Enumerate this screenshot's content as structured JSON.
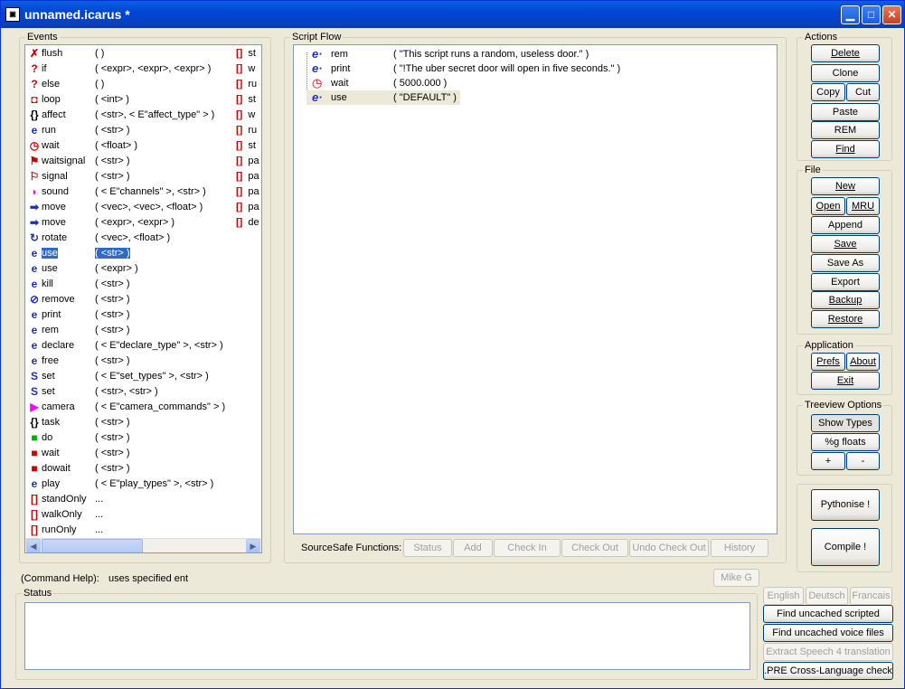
{
  "window": {
    "title": "unnamed.icarus *"
  },
  "events": {
    "legend": "Events",
    "items": [
      {
        "name": "flush",
        "args": "(  )",
        "icon": "flush-icon",
        "glyph": "✗",
        "color": "#d00000"
      },
      {
        "name": "if",
        "args": "( <expr>, <expr>, <expr> )",
        "icon": "if-icon",
        "glyph": "?",
        "color": "#d00000"
      },
      {
        "name": "else",
        "args": "(  )",
        "icon": "else-icon",
        "glyph": "?",
        "color": "#d00000"
      },
      {
        "name": "loop",
        "args": "( <int> )",
        "icon": "loop-icon",
        "glyph": "◘",
        "color": "#d00000"
      },
      {
        "name": "affect",
        "args": "( <str>, < E\"affect_type\" > )",
        "icon": "affect-icon",
        "glyph": "{}",
        "color": "#000000"
      },
      {
        "name": "run",
        "args": "( <str> )",
        "icon": "run-icon",
        "glyph": "e",
        "color": "#1d32b3"
      },
      {
        "name": "wait",
        "args": "( <float> )",
        "icon": "clock-icon",
        "glyph": "◷",
        "color": "#d00000"
      },
      {
        "name": "waitsignal",
        "args": "( <str> )",
        "icon": "waitsignal-icon",
        "glyph": "⚑",
        "color": "#d00000"
      },
      {
        "name": "signal",
        "args": "( <str> )",
        "icon": "signal-icon",
        "glyph": "⚐",
        "color": "#d00000"
      },
      {
        "name": "sound",
        "args": "( < E\"channels\" >, <str> )",
        "icon": "sound-icon",
        "glyph": "◗",
        "color": "#ff00ff"
      },
      {
        "name": "move",
        "args": "( <vec>, <vec>, <float> )",
        "icon": "move-arrow-icon",
        "glyph": "➡",
        "color": "#1d32b3"
      },
      {
        "name": "move",
        "args": "( <expr>, <expr> )",
        "icon": "move-arrow-icon",
        "glyph": "➡",
        "color": "#1d32b3"
      },
      {
        "name": "rotate",
        "args": "( <vec>, <float> )",
        "icon": "rotate-icon",
        "glyph": "↻",
        "color": "#1d32b3"
      },
      {
        "name": "use",
        "args": "( <str> )",
        "icon": "e-icon",
        "glyph": "e",
        "color": "#1d32b3"
      },
      {
        "name": "use",
        "args": "( <expr> )",
        "icon": "e-icon",
        "glyph": "e",
        "color": "#1d32b3"
      },
      {
        "name": "kill",
        "args": "( <str> )",
        "icon": "e-icon",
        "glyph": "e",
        "color": "#1d32b3"
      },
      {
        "name": "remove",
        "args": "( <str> )",
        "icon": "remove-icon",
        "glyph": "⊘",
        "color": "#1d32b3"
      },
      {
        "name": "print",
        "args": "( <str> )",
        "icon": "e-icon",
        "glyph": "e",
        "color": "#1d32b3"
      },
      {
        "name": "rem",
        "args": "( <str> )",
        "icon": "e-icon",
        "glyph": "e",
        "color": "#1d32b3"
      },
      {
        "name": "declare",
        "args": "( < E\"declare_type\" >, <str> )",
        "icon": "e-icon",
        "glyph": "e",
        "color": "#1d32b3"
      },
      {
        "name": "free",
        "args": "( <str> )",
        "icon": "e-icon",
        "glyph": "e",
        "color": "#1d32b3"
      },
      {
        "name": "set",
        "args": "( < E\"set_types\" >, <str> )",
        "icon": "set-icon",
        "glyph": "S",
        "color": "#1d32b3"
      },
      {
        "name": "set",
        "args": "( <str>, <str> )",
        "icon": "set-icon",
        "glyph": "S",
        "color": "#1d32b3"
      },
      {
        "name": "camera",
        "args": "( < E\"camera_commands\" > )",
        "icon": "camera-icon",
        "glyph": "▶",
        "color": "#ff00ff"
      },
      {
        "name": "task",
        "args": "( <str> )",
        "icon": "task-icon",
        "glyph": "{}",
        "color": "#000000"
      },
      {
        "name": "do",
        "args": "( <str> )",
        "icon": "do-icon",
        "glyph": "■",
        "color": "#00b000"
      },
      {
        "name": "wait",
        "args": "( <str> )",
        "icon": "wait-red-icon",
        "glyph": "■",
        "color": "#d00000"
      },
      {
        "name": "dowait",
        "args": "( <str> )",
        "icon": "dowait-icon",
        "glyph": "■",
        "color": "#d00000"
      },
      {
        "name": "play",
        "args": "( < E\"play_types\" >, <str> )",
        "icon": "e-icon",
        "glyph": "e",
        "color": "#1d32b3"
      },
      {
        "name": "standOnly",
        "args": "...",
        "icon": "bracket-icon",
        "glyph": "[]",
        "color": "#d00000"
      },
      {
        "name": "walkOnly",
        "args": "...",
        "icon": "bracket-icon",
        "glyph": "[]",
        "color": "#d00000"
      },
      {
        "name": "runOnly",
        "args": "...",
        "icon": "bracket-icon",
        "glyph": "[]",
        "color": "#d00000"
      }
    ],
    "second_column": [
      "st",
      "w",
      "ru",
      "st",
      "w",
      "ru",
      "st",
      "pa",
      "pa",
      "pa",
      "pa",
      "de"
    ]
  },
  "script_flow": {
    "legend": "Script Flow",
    "rows": [
      {
        "name": "rem",
        "args": "( \"This script runs a random, useless door.\" )",
        "icon": "e-icon"
      },
      {
        "name": "print",
        "args": "( \"!The uber secret door will open in five seconds.\" )",
        "icon": "e-icon"
      },
      {
        "name": "wait",
        "args": "( 5000.000 )",
        "icon": "clock-icon"
      },
      {
        "name": "use",
        "args": "( \"DEFAULT\" )",
        "icon": "e-icon"
      }
    ]
  },
  "sourcesafe": {
    "label": "SourceSafe Functions:",
    "buttons": [
      "Status",
      "Add",
      "Check In",
      "Check Out",
      "Undo Check Out",
      "History"
    ]
  },
  "actions": {
    "legend": "Actions",
    "delete": "Delete",
    "clone": "Clone",
    "copy": "Copy",
    "cut": "Cut",
    "paste": "Paste",
    "rem": "REM",
    "find": "Find"
  },
  "file": {
    "legend": "File",
    "new": "New",
    "open": "Open",
    "mru": "MRU",
    "append": "Append",
    "save": "Save",
    "save_as": "Save As",
    "export": "Export",
    "backup": "Backup",
    "restore": "Restore"
  },
  "application": {
    "legend": "Application",
    "prefs": "Prefs",
    "about": "About",
    "exit": "Exit"
  },
  "treeview": {
    "legend": "Treeview Options",
    "show_types": "Show Types",
    "g_floats": "%g floats",
    "plus": "+",
    "minus": "-"
  },
  "build": {
    "pythonise": "Pythonise !",
    "compile": "Compile !"
  },
  "command_help": {
    "label": "(Command Help):",
    "text": "uses specified ent"
  },
  "user_button": "Mike G",
  "status": {
    "legend": "Status"
  },
  "languages": [
    "English",
    "Deutsch",
    "Francais"
  ],
  "tools": {
    "find_audio": "Find uncached scripted audio",
    "find_voice": "Find uncached voice files",
    "extract_speech": "Extract Speech 4 translation",
    "pre_check": ".PRE Cross-Language check"
  }
}
